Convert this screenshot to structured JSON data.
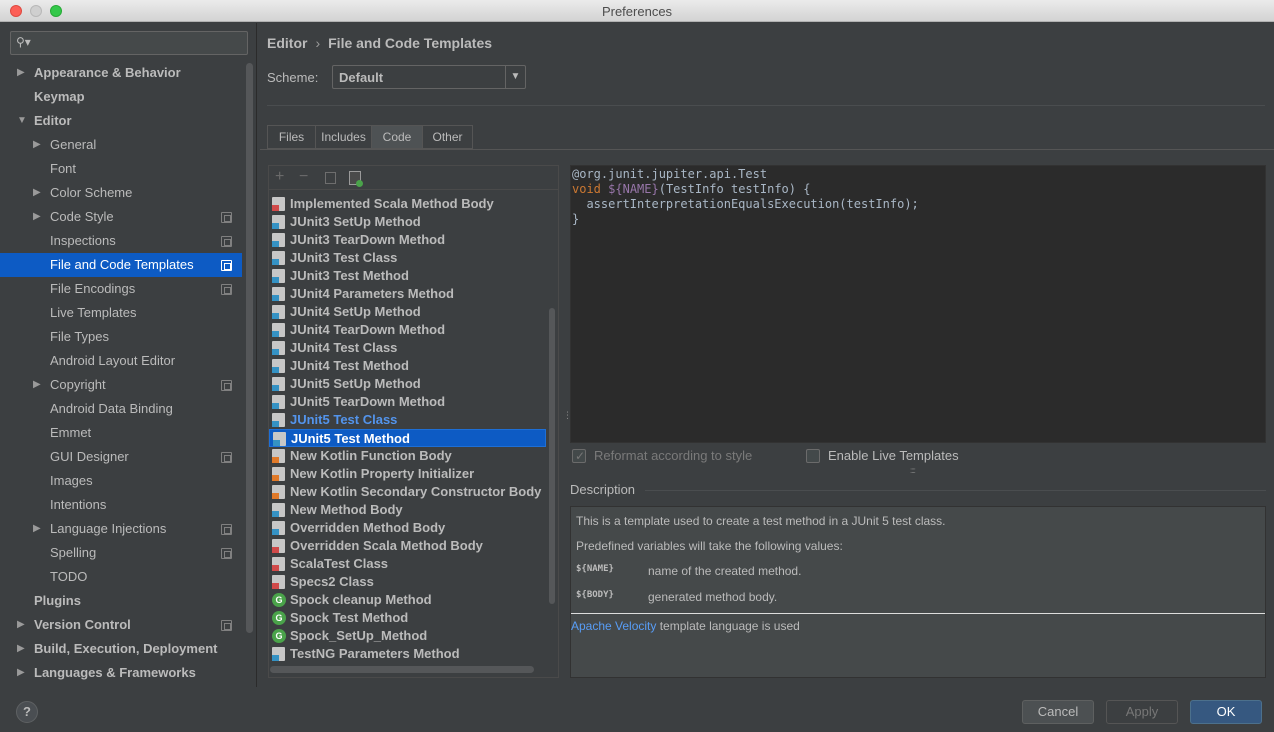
{
  "window": {
    "title": "Preferences"
  },
  "sidebar": {
    "search_placeholder": "",
    "items": [
      {
        "label": "Appearance & Behavior",
        "level": 0,
        "arrow": "collapsed",
        "bold": true
      },
      {
        "label": "Keymap",
        "level": 0,
        "arrow": "none",
        "bold": true
      },
      {
        "label": "Editor",
        "level": 0,
        "arrow": "expanded",
        "bold": true
      },
      {
        "label": "General",
        "level": 1,
        "arrow": "collapsed"
      },
      {
        "label": "Font",
        "level": 1,
        "arrow": "none"
      },
      {
        "label": "Color Scheme",
        "level": 1,
        "arrow": "collapsed"
      },
      {
        "label": "Code Style",
        "level": 1,
        "arrow": "collapsed",
        "copy": true
      },
      {
        "label": "Inspections",
        "level": 1,
        "arrow": "none",
        "copy": true
      },
      {
        "label": "File and Code Templates",
        "level": 1,
        "arrow": "none",
        "copy": true,
        "selected": true
      },
      {
        "label": "File Encodings",
        "level": 1,
        "arrow": "none",
        "copy": true
      },
      {
        "label": "Live Templates",
        "level": 1,
        "arrow": "none"
      },
      {
        "label": "File Types",
        "level": 1,
        "arrow": "none"
      },
      {
        "label": "Android Layout Editor",
        "level": 1,
        "arrow": "none"
      },
      {
        "label": "Copyright",
        "level": 1,
        "arrow": "collapsed",
        "copy": true
      },
      {
        "label": "Android Data Binding",
        "level": 1,
        "arrow": "none"
      },
      {
        "label": "Emmet",
        "level": 1,
        "arrow": "none"
      },
      {
        "label": "GUI Designer",
        "level": 1,
        "arrow": "none",
        "copy": true
      },
      {
        "label": "Images",
        "level": 1,
        "arrow": "none"
      },
      {
        "label": "Intentions",
        "level": 1,
        "arrow": "none"
      },
      {
        "label": "Language Injections",
        "level": 1,
        "arrow": "collapsed",
        "copy": true
      },
      {
        "label": "Spelling",
        "level": 1,
        "arrow": "none",
        "copy": true
      },
      {
        "label": "TODO",
        "level": 1,
        "arrow": "none"
      },
      {
        "label": "Plugins",
        "level": 0,
        "arrow": "none",
        "bold": true
      },
      {
        "label": "Version Control",
        "level": 0,
        "arrow": "collapsed",
        "bold": true,
        "copy": true
      },
      {
        "label": "Build, Execution, Deployment",
        "level": 0,
        "arrow": "collapsed",
        "bold": true
      },
      {
        "label": "Languages & Frameworks",
        "level": 0,
        "arrow": "collapsed",
        "bold": true
      }
    ],
    "help_label": "?"
  },
  "header": {
    "breadcrumb": [
      "Editor",
      "File and Code Templates"
    ],
    "breadcrumb_sep": "›",
    "scheme_label": "Scheme:",
    "scheme_value": "Default"
  },
  "tabs": [
    {
      "label": "Files",
      "active": false
    },
    {
      "label": "Includes",
      "active": false
    },
    {
      "label": "Code",
      "active": true
    },
    {
      "label": "Other",
      "active": false
    }
  ],
  "toolbar": {
    "add": "+",
    "remove": "−"
  },
  "templates": [
    {
      "label": "Implemented Scala Method Body",
      "icon": "scala"
    },
    {
      "label": "JUnit3 SetUp Method",
      "icon": "file"
    },
    {
      "label": "JUnit3 TearDown Method",
      "icon": "file"
    },
    {
      "label": "JUnit3 Test Class",
      "icon": "file"
    },
    {
      "label": "JUnit3 Test Method",
      "icon": "file"
    },
    {
      "label": "JUnit4 Parameters Method",
      "icon": "file"
    },
    {
      "label": "JUnit4 SetUp Method",
      "icon": "file"
    },
    {
      "label": "JUnit4 TearDown Method",
      "icon": "file"
    },
    {
      "label": "JUnit4 Test Class",
      "icon": "file"
    },
    {
      "label": "JUnit4 Test Method",
      "icon": "file"
    },
    {
      "label": "JUnit5 SetUp Method",
      "icon": "file"
    },
    {
      "label": "JUnit5 TearDown Method",
      "icon": "file"
    },
    {
      "label": "JUnit5 Test Class",
      "icon": "file",
      "modified": true
    },
    {
      "label": "JUnit5 Test Method",
      "icon": "file",
      "selected": true
    },
    {
      "label": "New Kotlin Function Body",
      "icon": "kotlin"
    },
    {
      "label": "New Kotlin Property Initializer",
      "icon": "kotlin"
    },
    {
      "label": "New Kotlin Secondary Constructor Body",
      "icon": "kotlin"
    },
    {
      "label": "New Method Body",
      "icon": "file"
    },
    {
      "label": "Overridden Method Body",
      "icon": "file"
    },
    {
      "label": "Overridden Scala Method Body",
      "icon": "scala"
    },
    {
      "label": "ScalaTest Class",
      "icon": "scala"
    },
    {
      "label": "Specs2 Class",
      "icon": "scala"
    },
    {
      "label": "Spock cleanup Method",
      "icon": "groovy"
    },
    {
      "label": "Spock Test Method",
      "icon": "groovy"
    },
    {
      "label": "Spock_SetUp_Method",
      "icon": "groovy"
    },
    {
      "label": "TestNG Parameters Method",
      "icon": "file"
    }
  ],
  "editor": {
    "line1": "@org.junit.jupiter.api.Test",
    "line2_kw": "void",
    "line2_var": "${NAME}",
    "line2_rest": "(TestInfo testInfo) {",
    "line3": "  assertInterpretationEqualsExecution(testInfo);",
    "line4": "}"
  },
  "options": {
    "reformat_label": "Reformat according to style",
    "reformat_checked": true,
    "live_templates_label": "Enable Live Templates",
    "live_templates_checked": false
  },
  "description": {
    "title": "Description",
    "intro": "This is a template used to create a test method in a JUnit 5 test class.",
    "predefined": "Predefined variables will take the following values:",
    "vars": [
      {
        "name": "${NAME}",
        "desc": "name of the created method."
      },
      {
        "name": "${BODY}",
        "desc": "generated method body."
      }
    ],
    "velocity_link": "Apache Velocity",
    "velocity_text": " template language is used"
  },
  "buttons": {
    "cancel": "Cancel",
    "apply": "Apply",
    "ok": "OK"
  },
  "colors": {
    "selection": "#0d5bc4",
    "modified": "#5394ec",
    "ok_button": "#365880",
    "background": "#3c3f41"
  }
}
